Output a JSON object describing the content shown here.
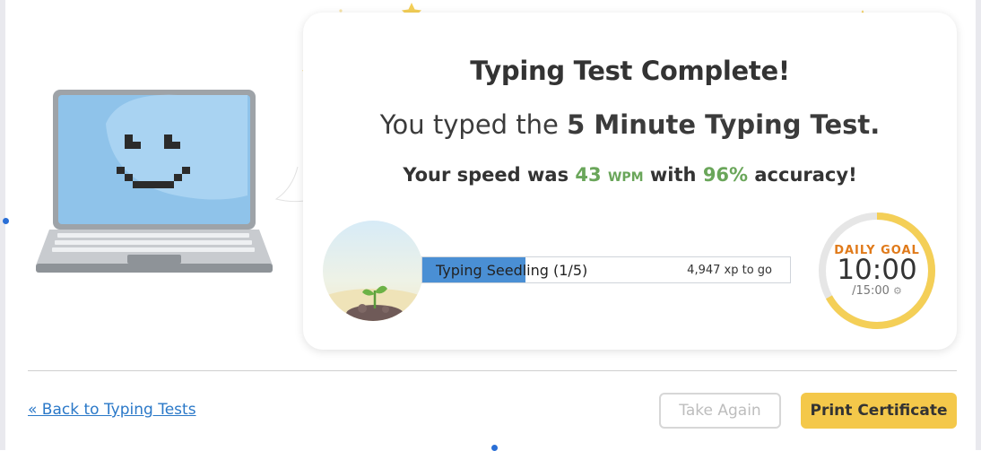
{
  "result": {
    "title": "Typing Test Complete!",
    "subtitle_prefix": "You typed the ",
    "subtitle_test": "5 Minute Typing Test.",
    "speed_prefix": "Your speed was ",
    "wpm": "43",
    "wpm_unit": "WPM",
    "speed_middle": " with ",
    "accuracy": "96%",
    "speed_suffix": " accuracy!"
  },
  "level": {
    "label": "Typing Seedling (1/5)",
    "xp_to_go": "4,947 xp to go",
    "progress_fraction": 0.28
  },
  "daily_goal": {
    "label": "DAILY GOAL",
    "time": "10:00",
    "total": "/15:00",
    "progress_fraction": 0.67,
    "ring_color": "#f4cf57"
  },
  "footer": {
    "back_link": "« Back to Typing Tests",
    "take_again": "Take Again",
    "print_certificate": "Print Certificate"
  },
  "colors": {
    "accent_green": "#6aa65a",
    "progress_blue": "#4a8fd4",
    "goal_orange": "#e07a1a",
    "print_button": "#f4c84a",
    "link_blue": "#2a78c8"
  }
}
